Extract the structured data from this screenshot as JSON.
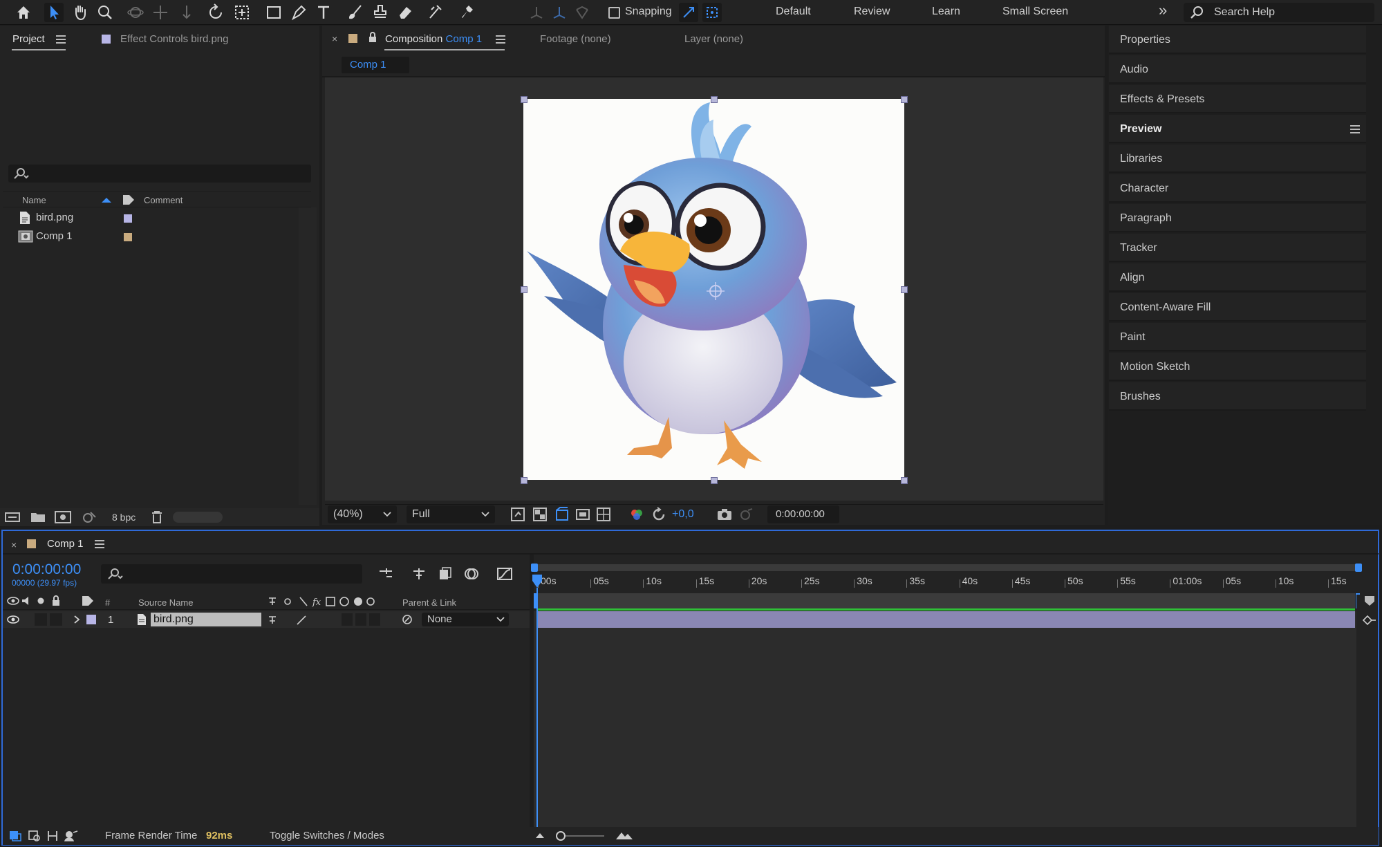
{
  "toolbar": {
    "snapping_label": "Snapping",
    "workspaces": [
      "Default",
      "Review",
      "Learn",
      "Small Screen"
    ],
    "more_label": "»",
    "search_placeholder": "Search Help"
  },
  "project_panel": {
    "tab_project": "Project",
    "tab_effect_controls": "Effect Controls bird.png",
    "columns": {
      "name": "Name",
      "comment": "Comment"
    },
    "items": [
      {
        "name": "bird.png",
        "label_color": "#b7b5e6"
      },
      {
        "name": "Comp 1",
        "label_color": "#c9ab7f"
      }
    ],
    "bit_depth": "8 bpc"
  },
  "viewer": {
    "tab_composition_prefix": "Composition",
    "tab_composition_name": "Comp 1",
    "tab_footage": "Footage (none)",
    "tab_layer": "Layer (none)",
    "breadcrumb": "Comp 1",
    "zoom": "(40%)",
    "resolution": "Full",
    "exposure": "+0,0",
    "timecode": "0:00:00:00"
  },
  "right_panels": [
    {
      "label": "Properties",
      "bold": false
    },
    {
      "label": "Audio",
      "bold": false
    },
    {
      "label": "Effects & Presets",
      "bold": false
    },
    {
      "label": "Preview",
      "bold": true
    },
    {
      "label": "Libraries",
      "bold": false
    },
    {
      "label": "Character",
      "bold": false
    },
    {
      "label": "Paragraph",
      "bold": false
    },
    {
      "label": "Tracker",
      "bold": false
    },
    {
      "label": "Align",
      "bold": false
    },
    {
      "label": "Content-Aware Fill",
      "bold": false
    },
    {
      "label": "Paint",
      "bold": false
    },
    {
      "label": "Motion Sketch",
      "bold": false
    },
    {
      "label": "Brushes",
      "bold": false
    }
  ],
  "timeline": {
    "tab_label": "Comp 1",
    "current_time": "0:00:00:00",
    "frame_info": "00000 (29.97 fps)",
    "columns": {
      "number": "#",
      "source_name": "Source Name",
      "parent_link": "Parent & Link"
    },
    "layers": [
      {
        "index": "1",
        "name": "bird.png",
        "parent": "None"
      }
    ],
    "ruler_labels": [
      "00s",
      "05s",
      "10s",
      "15s",
      "20s",
      "25s",
      "30s",
      "35s",
      "40s",
      "45s",
      "50s",
      "55s",
      "01:00s",
      "05s",
      "10s",
      "15s"
    ],
    "frame_render_label": "Frame Render Time",
    "frame_render_value": "92ms",
    "toggle_label": "Toggle Switches / Modes"
  },
  "colors": {
    "accent_blue": "#3d8ff7",
    "comp_label": "#c9ab7f",
    "layer_bar": "#8a87b4",
    "work_area_green": "#2fbf37"
  }
}
